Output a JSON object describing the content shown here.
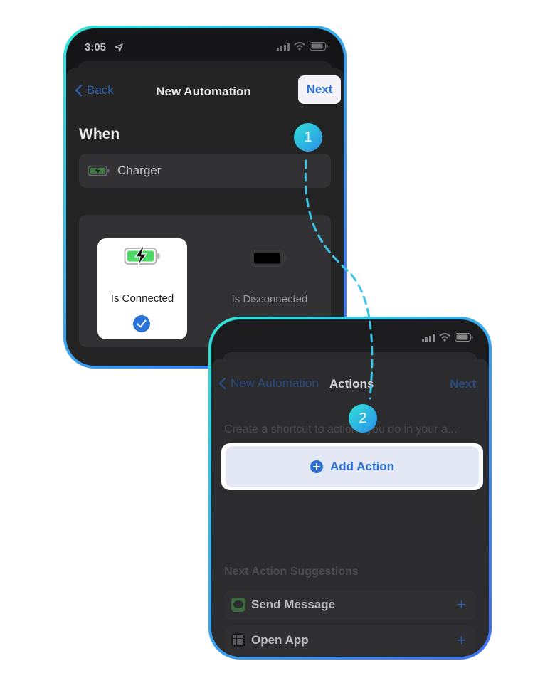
{
  "screen1": {
    "status_time": "3:05",
    "nav": {
      "back_label": "Back",
      "title": "New Automation",
      "next_label": "Next"
    },
    "section_title": "When",
    "trigger_label": "Charger",
    "options": [
      {
        "label": "Is Connected",
        "selected": true
      },
      {
        "label": "Is Disconnected",
        "selected": false
      }
    ]
  },
  "screen2": {
    "nav": {
      "back_label": "New Automation",
      "title": "Actions",
      "next_label": "Next"
    },
    "hint_text": "Create a shortcut to actions you do in your a...",
    "add_action_label": "Add Action",
    "suggestions_title": "Next Action Suggestions",
    "suggestions": [
      {
        "label": "Send Message",
        "icon": "messages-icon"
      },
      {
        "label": "Open App",
        "icon": "app-grid-icon"
      }
    ]
  },
  "steps": [
    {
      "label": "1"
    },
    {
      "label": "2"
    }
  ],
  "colors": {
    "accent": "#2a72d8",
    "frame_start": "#2ee6d6",
    "frame_end": "#3f6ff0",
    "battery_green": "#4cd964"
  }
}
